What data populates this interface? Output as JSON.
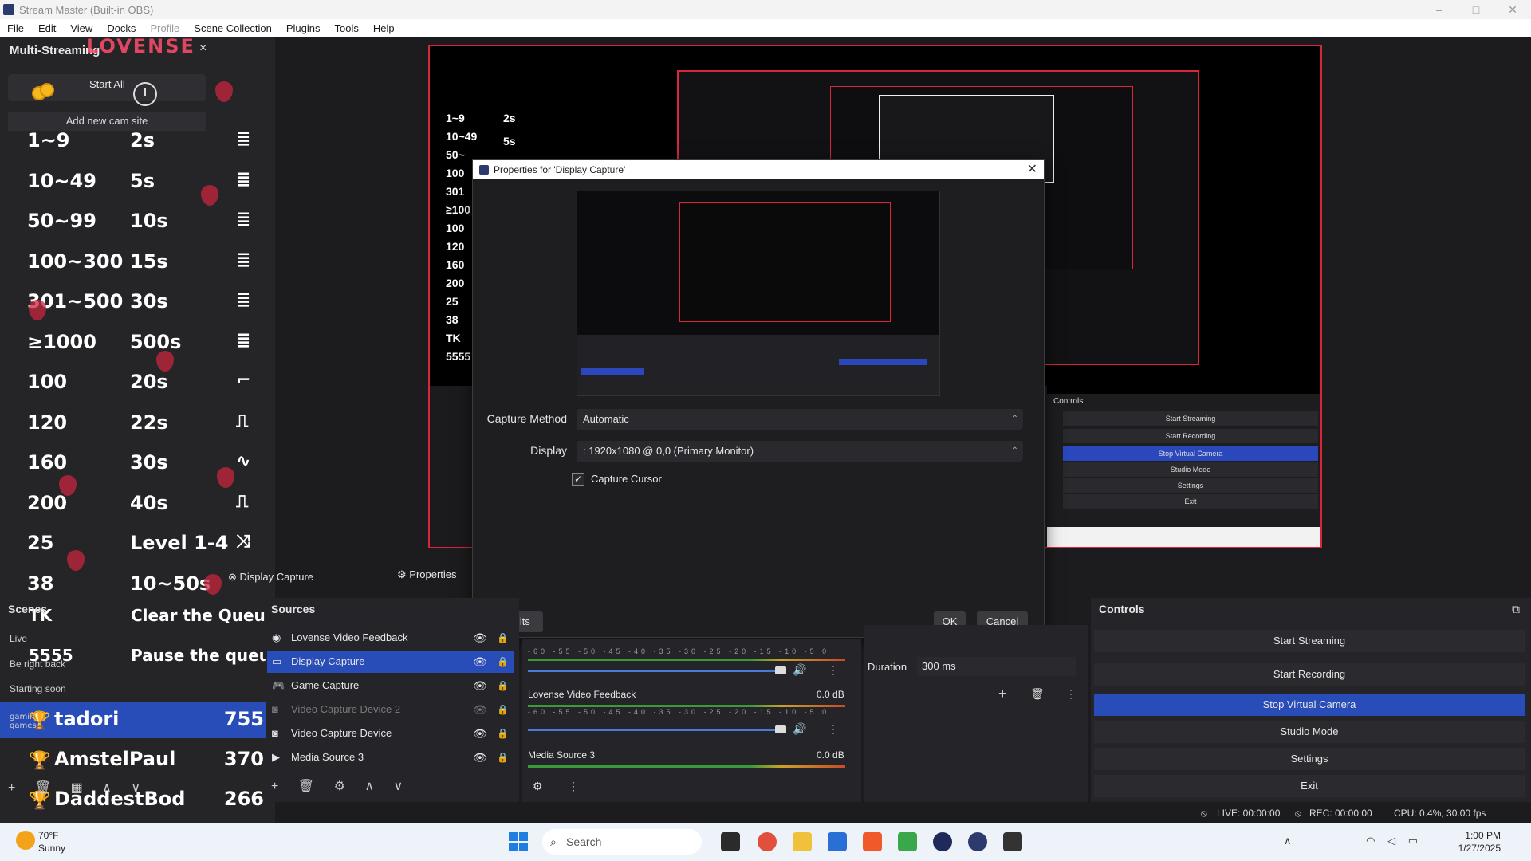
{
  "window": {
    "title": "Stream Master (Built-in OBS)",
    "minimize": "–",
    "maximize": "□",
    "close": "✕"
  },
  "menu": [
    "File",
    "Edit",
    "View",
    "Docks",
    "Profile",
    "Scene Collection",
    "Plugins",
    "Tools",
    "Help"
  ],
  "multistream": {
    "title": "Multi-Streaming",
    "logo": "LOVENSE",
    "close": "×",
    "start_all": "Start All",
    "add_cam": "Add new cam site",
    "levels": [
      {
        "range": "1~9",
        "time": "2s",
        "icon": "≣"
      },
      {
        "range": "10~49",
        "time": "5s",
        "icon": "≣"
      },
      {
        "range": "50~99",
        "time": "10s",
        "icon": "≣"
      },
      {
        "range": "100~300",
        "time": "15s",
        "icon": "≣"
      },
      {
        "range": "301~500",
        "time": "30s",
        "icon": "≣"
      },
      {
        "range": "≥1000",
        "time": "500s",
        "icon": "≣"
      },
      {
        "range": "100",
        "time": "20s",
        "icon": "⌐"
      },
      {
        "range": "120",
        "time": "22s",
        "icon": "⎍"
      },
      {
        "range": "160",
        "time": "30s",
        "icon": "∿"
      },
      {
        "range": "200",
        "time": "40s",
        "icon": "⎍"
      },
      {
        "range": "25",
        "time": "Level 1-4",
        "icon": "⤨"
      },
      {
        "range": "38",
        "time": "10~50s",
        "icon": ""
      }
    ],
    "tk": "TK",
    "clear_queue": "Clear the Queue",
    "n5555": "5555",
    "pause_queue": "Pause the queue"
  },
  "scenes": {
    "header": "Scenes",
    "items": [
      "Live",
      "Be right back",
      "Starting soon",
      "gaming games"
    ]
  },
  "leaderboard": [
    {
      "name": "tadori",
      "score": "755"
    },
    {
      "name": "AmstelPaul",
      "score": "370"
    },
    {
      "name": "DaddestBod",
      "score": "266"
    }
  ],
  "preview_mini": [
    "1~9",
    "10~49",
    "50~",
    "100",
    "301",
    "≥100",
    "100",
    "120",
    "160",
    "200",
    "25",
    "38",
    "TK",
    "5555"
  ],
  "preview_mini_times": [
    "2s",
    "5s"
  ],
  "preview_controls": {
    "header": "Controls",
    "items": [
      "Start Streaming",
      "Start Recording",
      "Stop Virtual Camera",
      "Studio Mode",
      "Settings",
      "Exit"
    ]
  },
  "dialog": {
    "title": "Properties for 'Display Capture'",
    "close": "✕",
    "capture_method_label": "Capture Method",
    "capture_method_value": "Automatic",
    "display_label": "Display",
    "display_value": ": 1920x1080 @ 0,0 (Primary Monitor)",
    "capture_cursor_label": "Capture Cursor",
    "capture_cursor_checked": true,
    "defaults": "Defaults",
    "ok": "OK",
    "cancel": "Cancel"
  },
  "toolbar": {
    "source_name": "Display Capture",
    "properties": "Properties"
  },
  "sources": {
    "header": "Sources",
    "items": [
      {
        "name": "Lovense Video Feedback",
        "selected": false,
        "dim": false,
        "icon": "◉"
      },
      {
        "name": "Display Capture",
        "selected": true,
        "dim": false,
        "icon": "▭"
      },
      {
        "name": "Game Capture",
        "selected": false,
        "dim": false,
        "icon": "🎮"
      },
      {
        "name": "Video Capture Device 2",
        "selected": false,
        "dim": true,
        "icon": "◙"
      },
      {
        "name": "Video Capture Device",
        "selected": false,
        "dim": false,
        "icon": "◙"
      },
      {
        "name": "Media Source 3",
        "selected": false,
        "dim": false,
        "icon": "▶"
      }
    ]
  },
  "mixer": {
    "meter_scale": "-60 -55 -50 -45 -40 -35 -30 -25 -20 -15 -10 -5 0",
    "channels": [
      {
        "name": "Lovense Video Feedback",
        "level": "0.0 dB"
      },
      {
        "name": "Media Source 3",
        "level": "0.0 dB"
      }
    ]
  },
  "transitions": {
    "duration_label": "Duration",
    "duration_value": "300 ms"
  },
  "controls": {
    "header": "Controls",
    "buttons": [
      "Start Streaming",
      "Start Recording",
      "Stop Virtual Camera",
      "Studio Mode",
      "Settings",
      "Exit"
    ]
  },
  "status": {
    "live": "LIVE: 00:00:00",
    "rec": "REC: 00:00:00",
    "cpu": "CPU: 0.4%, 30.00 fps"
  },
  "taskbar": {
    "temp": "70°F",
    "condition": "Sunny",
    "search": "Search",
    "time": "1:00 PM",
    "date": "1/27/2025"
  },
  "colors": {
    "accent_blue": "#284cb8",
    "selection_red": "#d8263b",
    "panel_bg": "#252428"
  }
}
